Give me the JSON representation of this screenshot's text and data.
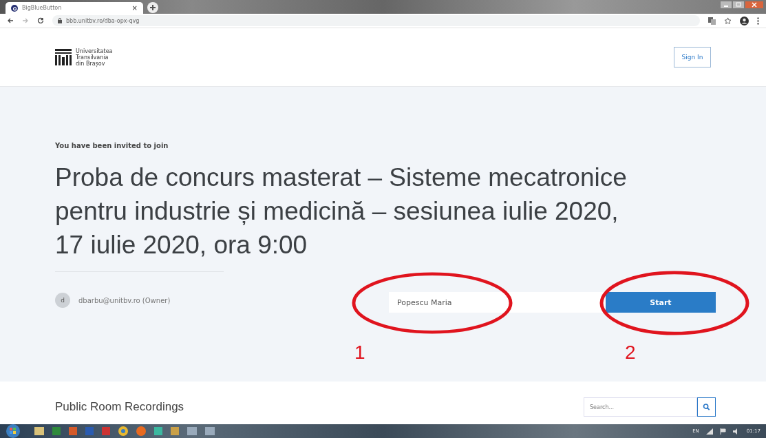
{
  "browser": {
    "tabs": [
      {
        "title": "BigBlueButton",
        "selected": true
      }
    ],
    "close_tab": "×",
    "url": "bbb.unitbv.ro/dba-opx-qvg"
  },
  "header": {
    "logo_text": [
      "Universitatea",
      "Transilvania",
      "din Brașov"
    ],
    "sign_in": "Sign In"
  },
  "join": {
    "invited": "You have been invited to join",
    "title": "Proba de concurs masterat – Sisteme mecatronice pentru industrie și medicină – sesiunea iulie 2020, 17 iulie 2020, ora 9:00",
    "avatar_letter": "d",
    "owner": "dbarbu@unitbv.ro (Owner)",
    "name_value": "Popescu Maria",
    "start": "Start"
  },
  "annotations": [
    {
      "label": "1"
    },
    {
      "label": "2"
    }
  ],
  "recordings": {
    "heading": "Public Room Recordings",
    "search_placeholder": "Search..."
  },
  "taskbar": {
    "language": "EN",
    "time": "01:17"
  }
}
